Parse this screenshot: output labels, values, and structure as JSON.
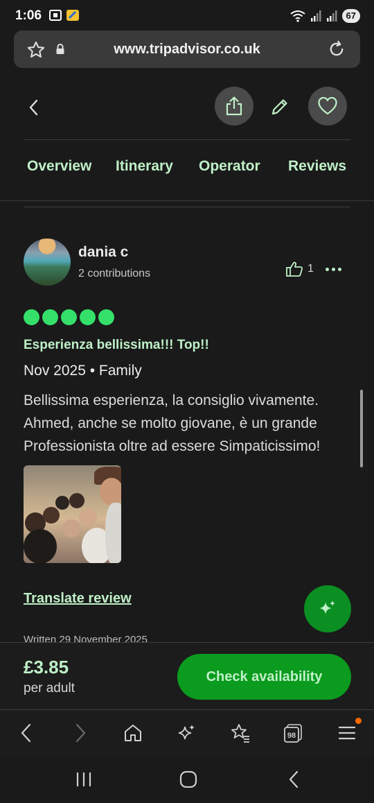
{
  "status_bar": {
    "time": "1:06",
    "battery": "67"
  },
  "browser": {
    "url": "www.tripadvisor.co.uk"
  },
  "tabs": [
    {
      "label": "Overview"
    },
    {
      "label": "Itinerary"
    },
    {
      "label": "Operator"
    },
    {
      "label": "Reviews"
    }
  ],
  "review": {
    "reviewer_name": "dania c",
    "contributions": "2 contributions",
    "helpful_count": "1",
    "rating": 5,
    "title": "Esperienza bellissima!!! Top!!",
    "meta": "Nov 2025 • Family",
    "body": "Bellissima esperienza, la consiglio vivamente. Ahmed, anche se molto giovane, è un grande Professionista oltre ad essere Simpaticissimo!",
    "translate_label": "Translate review",
    "written_date": "Written 29 November 2025"
  },
  "booking": {
    "price": "£3.85",
    "price_unit": "per adult",
    "cta_label": "Check availability"
  },
  "browser_toolbar": {
    "tab_count": "98"
  },
  "colors": {
    "accent_text": "#bff0c8",
    "rating_bubble": "#34e06a",
    "cta_green": "#0b9b1e",
    "background": "#1a1a1a"
  },
  "icons": {
    "status": [
      "screenshot-icon",
      "app-icon",
      "wifi-icon",
      "signal-icon",
      "battery-icon"
    ],
    "header": [
      "back-chevron-icon",
      "share-icon",
      "edit-pencil-icon",
      "heart-icon"
    ],
    "toolbar": [
      "back-icon",
      "forward-icon",
      "home-icon",
      "sparkle-icon",
      "bookmark-star-icon",
      "tabs-icon",
      "menu-icon"
    ],
    "android_nav": [
      "recents-icon",
      "home-circle-icon",
      "back-icon"
    ]
  }
}
